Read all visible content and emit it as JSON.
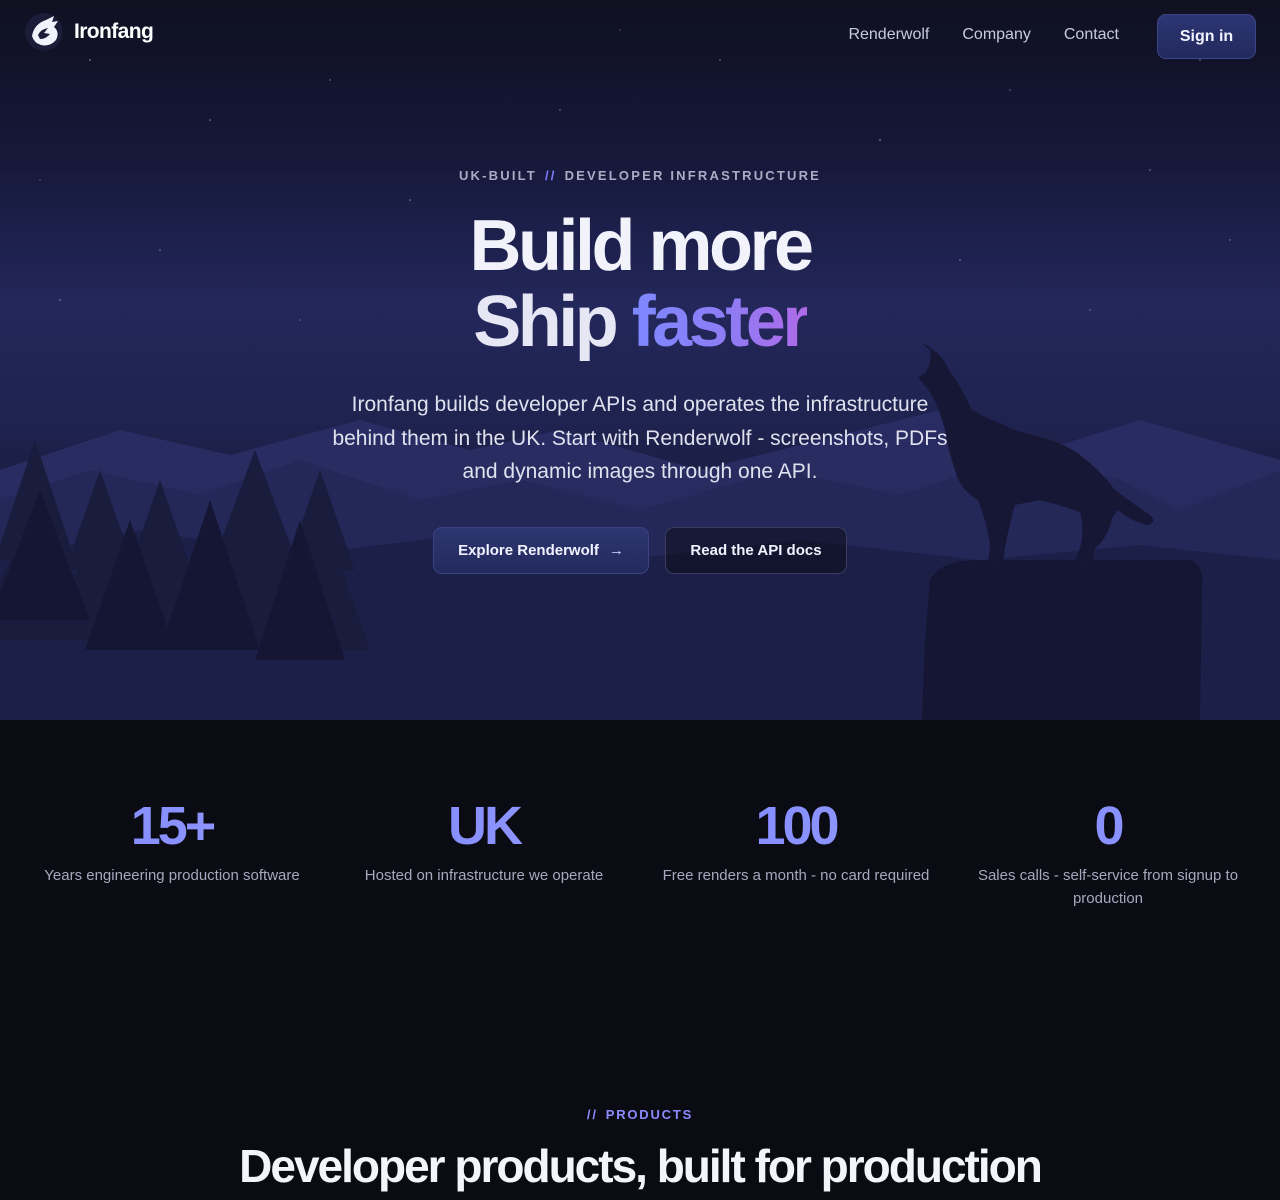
{
  "brand": {
    "name": "Ironfang",
    "logo_icon": "wolf-head-icon"
  },
  "nav": {
    "links": [
      "Renderwolf",
      "Company",
      "Contact"
    ],
    "signin_label": "Sign in"
  },
  "hero": {
    "eyebrow_left": "UK-BUILT",
    "eyebrow_sep": "//",
    "eyebrow_right": "DEVELOPER INFRASTRUCTURE",
    "headline_line1": "Build more",
    "headline_line2_a": "Ship",
    "headline_line2_b": "faster",
    "lede": "Ironfang builds developer APIs and operates the infrastructure behind them in the UK. Start with Renderwolf - screenshots, PDFs and dynamic images through one API.",
    "primary_cta": "Explore Renderwolf",
    "primary_cta_icon": "arrow-right-icon",
    "secondary_cta": "Read the API docs"
  },
  "stats": [
    {
      "value": "15+",
      "label": "Years engineering production software"
    },
    {
      "value": "UK",
      "label": "Hosted on infrastructure we operate"
    },
    {
      "value": "100",
      "label": "Free renders a month - no card required"
    },
    {
      "value": "0",
      "label": "Sales calls - self-service from signup to production"
    }
  ],
  "products": {
    "eyebrow_sep": "//",
    "eyebrow": "PRODUCTS",
    "title": "Developer products, built for production"
  },
  "colors": {
    "accent": "#7f86ff",
    "accent_purple": "#b06ae8",
    "background": "#0b0b14",
    "button": "#2a316a"
  }
}
